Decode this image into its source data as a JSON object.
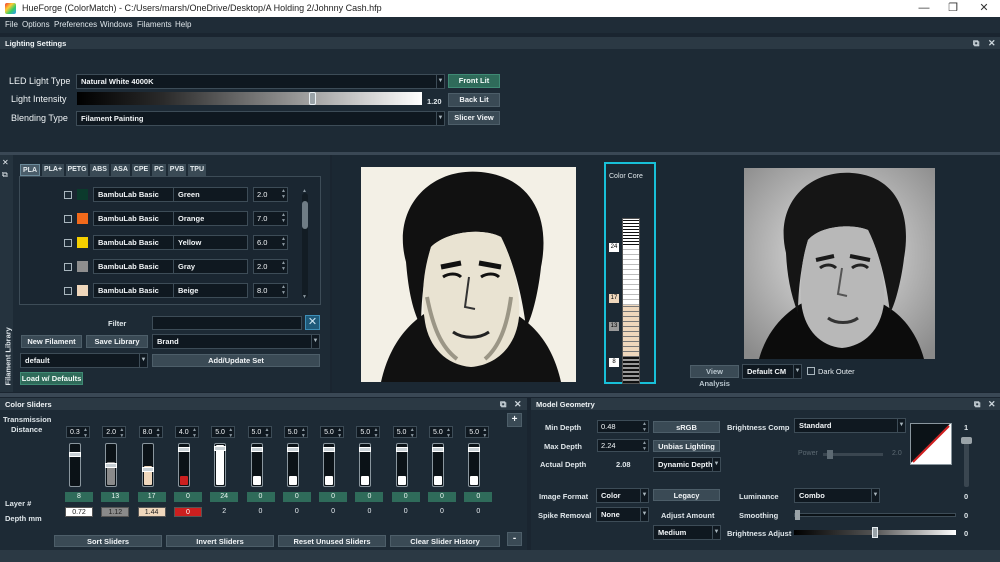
{
  "window": {
    "title": "HueForge (ColorMatch) - C:/Users/marsh/OneDrive/Desktop/A Holding 2/Johnny Cash.hfp",
    "minimize": "—",
    "maximize": "❐",
    "close": "✕"
  },
  "menu": [
    "File",
    "Options",
    "Preferences",
    "Windows",
    "Filaments",
    "Help"
  ],
  "lighting": {
    "title": "Lighting Settings",
    "led_label": "LED Light Type",
    "led_value": "Natural White 4000K",
    "intensity_label": "Light Intensity",
    "intensity_value": "1.20",
    "intensity_fraction": 0.68,
    "blending_label": "Blending Type",
    "blending_value": "Filament Painting",
    "front_lit": "Front Lit",
    "back_lit": "Back Lit",
    "slicer_view": "Slicer View"
  },
  "library": {
    "side_label": "Filament Library",
    "tabs": [
      "PLA",
      "PLA+",
      "PETG",
      "ABS",
      "ASA",
      "CPE",
      "PC",
      "PVB",
      "TPU"
    ],
    "filaments": [
      {
        "brand": "BambuLab Basic",
        "name": "Green",
        "td": "2.0",
        "color": "#0b3a2c"
      },
      {
        "brand": "BambuLab Basic",
        "name": "Orange",
        "td": "7.0",
        "color": "#f26a1b"
      },
      {
        "brand": "BambuLab Basic",
        "name": "Yellow",
        "td": "6.0",
        "color": "#f5d000"
      },
      {
        "brand": "BambuLab Basic",
        "name": "Gray",
        "td": "2.0",
        "color": "#8e8e8e"
      },
      {
        "brand": "BambuLab Basic",
        "name": "Beige",
        "td": "8.0",
        "color": "#efd7bc"
      }
    ],
    "filter_label": "Filter",
    "new_filament": "New Filament",
    "save_library": "Save Library",
    "brand_value": "Brand",
    "set_value": "default",
    "add_update_set": "Add/Update Set",
    "load_defaults": "Load w/ Defaults"
  },
  "color_core": {
    "label": "Color Core",
    "markers": [
      "24",
      "17",
      "13",
      "8"
    ]
  },
  "preview": {
    "view_analysis": "View Analysis",
    "cm_value": "Default CM",
    "dark_outer": "Dark Outer"
  },
  "sliders": {
    "title": "Color Sliders",
    "transmission": "Transmission",
    "distance": "Distance",
    "layer_label": "Layer #",
    "depth_label": "Depth mm",
    "add": "+",
    "remove": "-",
    "cols": [
      {
        "td": "0.3",
        "layer": "8",
        "depth": "0.72",
        "color": "#2a3a33",
        "fill": 0.0,
        "thumb": 0.82,
        "box": "#ffffff",
        "boxText": "#222"
      },
      {
        "td": "2.0",
        "layer": "13",
        "depth": "1.12",
        "color": "#8a8a8a",
        "fill": 0.55,
        "thumb": 0.55,
        "box": "#8a8a8a",
        "boxText": "#222"
      },
      {
        "td": "8.0",
        "layer": "17",
        "depth": "1.44",
        "color": "#efd7bc",
        "fill": 0.45,
        "thumb": 0.45,
        "box": "#efd7bc",
        "boxText": "#222"
      },
      {
        "td": "4.0",
        "layer": "0",
        "depth": "0",
        "color": "#cc1f1f",
        "fill": 0.22,
        "thumb": 0.92,
        "box": "#cc1f1f",
        "boxText": "#fff"
      },
      {
        "td": "5.0",
        "layer": "24",
        "depth": "2",
        "color": "#ffffff",
        "fill": 0.95,
        "thumb": 0.95,
        "box": "",
        "boxText": "#e8eef2"
      },
      {
        "td": "5.0",
        "layer": "0",
        "depth": "0",
        "color": "#ffffff",
        "fill": 0.22,
        "thumb": 0.92,
        "box": "",
        "boxText": "#e8eef2"
      },
      {
        "td": "5.0",
        "layer": "0",
        "depth": "0",
        "color": "#ffffff",
        "fill": 0.22,
        "thumb": 0.92,
        "box": "",
        "boxText": "#e8eef2"
      },
      {
        "td": "5.0",
        "layer": "0",
        "depth": "0",
        "color": "#ffffff",
        "fill": 0.22,
        "thumb": 0.92,
        "box": "",
        "boxText": "#e8eef2"
      },
      {
        "td": "5.0",
        "layer": "0",
        "depth": "0",
        "color": "#ffffff",
        "fill": 0.22,
        "thumb": 0.92,
        "box": "",
        "boxText": "#e8eef2"
      },
      {
        "td": "5.0",
        "layer": "0",
        "depth": "0",
        "color": "#ffffff",
        "fill": 0.22,
        "thumb": 0.92,
        "box": "",
        "boxText": "#e8eef2"
      },
      {
        "td": "5.0",
        "layer": "0",
        "depth": "0",
        "color": "#ffffff",
        "fill": 0.22,
        "thumb": 0.92,
        "box": "",
        "boxText": "#e8eef2"
      },
      {
        "td": "5.0",
        "layer": "0",
        "depth": "0",
        "color": "#ffffff",
        "fill": 0.22,
        "thumb": 0.92,
        "box": "",
        "boxText": "#e8eef2"
      }
    ],
    "sort": "Sort Sliders",
    "invert": "Invert Sliders",
    "reset": "Reset Unused Sliders",
    "clear": "Clear Slider History"
  },
  "geometry": {
    "title": "Model Geometry",
    "min_depth_label": "Min Depth",
    "min_depth": "0.48",
    "max_depth_label": "Max Depth",
    "max_depth": "2.24",
    "actual_depth_label": "Actual Depth",
    "actual_depth": "2.08",
    "srgb": "sRGB",
    "unbias": "Unbias Lighting",
    "dynamic_depth": "Dynamic Depth",
    "brightness_comp_label": "Brightness Comp",
    "brightness_comp": "Standard",
    "power_label": "Power",
    "power_value": "2.0",
    "image_format_label": "Image Format",
    "image_format": "Color",
    "legacy": "Legacy",
    "spike_label": "Spike Removal",
    "spike_value": "None",
    "adjust_amount": "Adjust Amount",
    "medium": "Medium",
    "luminance_label": "Luminance",
    "luminance": "Combo",
    "smoothing_label": "Smoothing",
    "smoothing_value": "0",
    "brightness_adjust_label": "Brightness Adjust",
    "brightness_adjust_value": "0",
    "vslider_top": "1",
    "vslider_bottom": "0"
  }
}
